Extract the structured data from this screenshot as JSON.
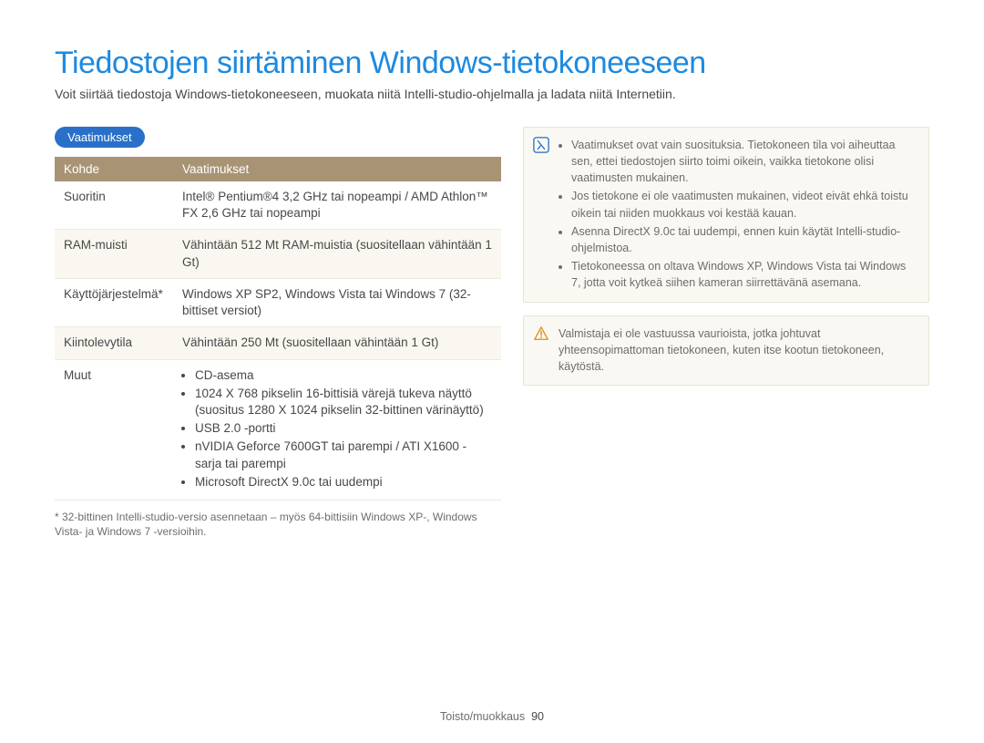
{
  "heading": "Tiedostojen siirtäminen Windows-tietokoneeseen",
  "intro": "Voit siirtää tiedostoja Windows-tietokoneeseen, muokata niitä Intelli-studio-ohjelmalla ja ladata niitä Internetiin.",
  "section_badge": "Vaatimukset",
  "table": {
    "head_item": "Kohde",
    "head_req": "Vaatimukset",
    "rows": [
      {
        "item": "Suoritin",
        "req": "Intel® Pentium®4 3,2 GHz tai nopeampi / AMD Athlon™ FX 2,6 GHz tai nopeampi"
      },
      {
        "item": "RAM-muisti",
        "req": "Vähintään 512 Mt RAM-muistia (suositellaan vähintään 1 Gt)"
      },
      {
        "item": "Käyttöjärjestelmä*",
        "req": "Windows XP SP2, Windows Vista tai Windows 7 (32-bittiset versiot)"
      },
      {
        "item": "Kiintolevytila",
        "req": "Vähintään 250 Mt (suositellaan vähintään 1 Gt)"
      }
    ],
    "other_item": "Muut",
    "other_bullets": [
      "CD-asema",
      "1024 X 768 pikselin 16-bittisiä värejä tukeva näyttö (suositus 1280 X 1024 pikselin 32-bittinen värinäyttö)",
      "USB 2.0 -portti",
      "nVIDIA Geforce 7600GT tai parempi / ATI X1600 -sarja tai parempi",
      "Microsoft DirectX 9.0c tai uudempi"
    ]
  },
  "footnote": "* 32-bittinen Intelli-studio-versio asennetaan – myös 64-bittisiin Windows XP-, Windows Vista- ja Windows 7 -versioihin.",
  "info_bullets": [
    "Vaatimukset ovat vain suosituksia. Tietokoneen tila voi aiheuttaa sen, ettei tiedostojen siirto toimi oikein, vaikka tietokone olisi vaatimusten mukainen.",
    "Jos tietokone ei ole vaatimusten mukainen, videot eivät ehkä toistu oikein tai niiden muokkaus voi kestää kauan.",
    "Asenna DirectX 9.0c tai uudempi, ennen kuin käytät Intelli-studio-ohjelmistoa.",
    "Tietokoneessa on oltava Windows XP, Windows Vista tai Windows 7, jotta voit kytkeä siihen kameran siirrettävänä asemana."
  ],
  "warning_text": "Valmistaja ei ole vastuussa vaurioista, jotka johtuvat yhteensopimattoman tietokoneen, kuten itse kootun tietokoneen, käytöstä.",
  "footer_section": "Toisto/muokkaus",
  "footer_page": "90"
}
